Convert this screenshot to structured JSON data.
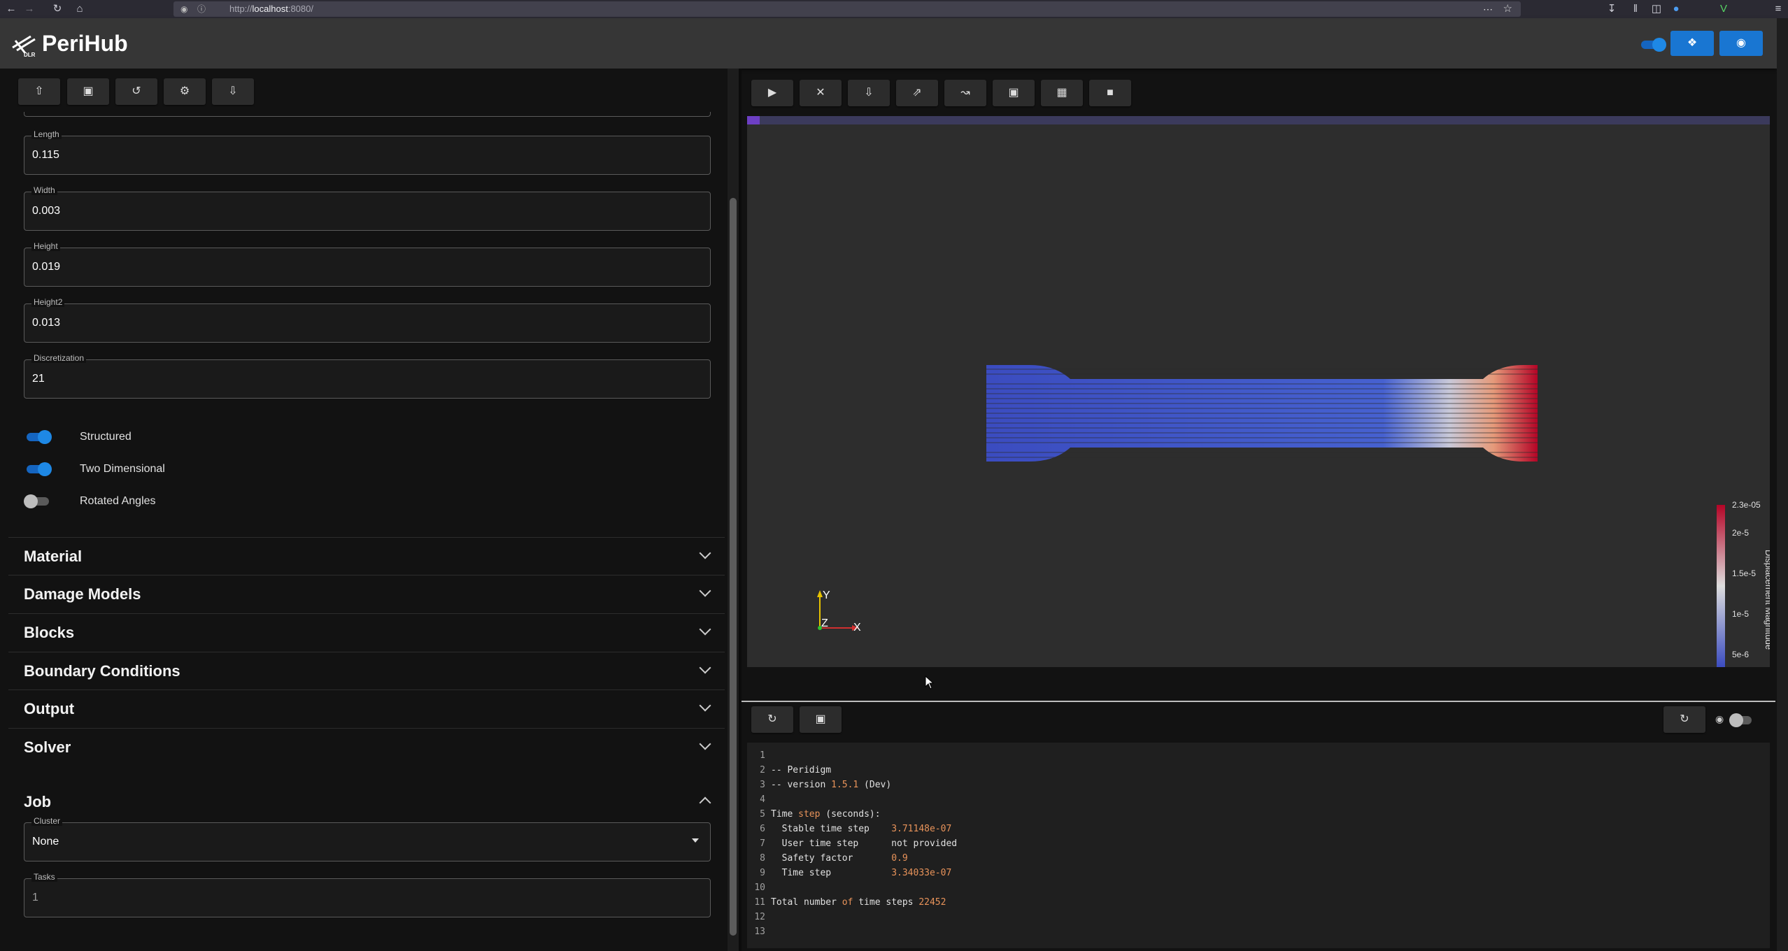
{
  "browser": {
    "url_prefix": "http://",
    "url_host": "localhost",
    "url_rest": ":8080/"
  },
  "app": {
    "title": "PeriHub",
    "logo_text": "DLR"
  },
  "geometry": {
    "fields": [
      {
        "label": "Length",
        "value": "0.115"
      },
      {
        "label": "Width",
        "value": "0.003"
      },
      {
        "label": "Height",
        "value": "0.019"
      },
      {
        "label": "Height2",
        "value": "0.013"
      },
      {
        "label": "Discretization",
        "value": "21"
      }
    ],
    "switches": [
      {
        "label": "Structured",
        "on": true
      },
      {
        "label": "Two Dimensional",
        "on": true
      },
      {
        "label": "Rotated Angles",
        "on": false
      }
    ]
  },
  "panels": [
    {
      "title": "Material",
      "expanded": false
    },
    {
      "title": "Damage Models",
      "expanded": false
    },
    {
      "title": "Blocks",
      "expanded": false
    },
    {
      "title": "Boundary Conditions",
      "expanded": false
    },
    {
      "title": "Output",
      "expanded": false
    },
    {
      "title": "Solver",
      "expanded": false
    },
    {
      "title": "Job",
      "expanded": true
    }
  ],
  "job": {
    "cluster_label": "Cluster",
    "cluster_value": "None",
    "tasks_label": "Tasks",
    "tasks_value": "1"
  },
  "viewer": {
    "colorbar_ticks": [
      "2.3e-05",
      "2e-5",
      "1.5e-5",
      "1e-5",
      "5e-6"
    ],
    "colorbar_title": "Displacement Magnitude",
    "axes": {
      "y": "Y",
      "x": "X",
      "z": "Z"
    },
    "colors": {
      "low": "#3b4cc0",
      "mid": "#dddddd",
      "high": "#b40426"
    }
  },
  "log": {
    "lines": [
      {
        "n": "1",
        "parts": []
      },
      {
        "n": "2",
        "parts": [
          {
            "t": "-- Peridigm"
          }
        ]
      },
      {
        "n": "3",
        "parts": [
          {
            "t": "-- version "
          },
          {
            "t": "1.5.1",
            "h": true
          },
          {
            "t": " (Dev)"
          }
        ]
      },
      {
        "n": "4",
        "parts": []
      },
      {
        "n": "5",
        "parts": [
          {
            "t": "Time "
          },
          {
            "t": "step",
            "h": true
          },
          {
            "t": " (seconds):"
          }
        ]
      },
      {
        "n": "6",
        "parts": [
          {
            "t": "  Stable time step    "
          },
          {
            "t": "3.71148e-07",
            "h": true
          }
        ]
      },
      {
        "n": "7",
        "parts": [
          {
            "t": "  User time step      not provided"
          }
        ]
      },
      {
        "n": "8",
        "parts": [
          {
            "t": "  Safety factor       "
          },
          {
            "t": "0.9",
            "h": true
          }
        ]
      },
      {
        "n": "9",
        "parts": [
          {
            "t": "  Time step           "
          },
          {
            "t": "3.34033e-07",
            "h": true
          }
        ]
      },
      {
        "n": "10",
        "parts": []
      },
      {
        "n": "11",
        "parts": [
          {
            "t": "Total number "
          },
          {
            "t": "of",
            "h": true
          },
          {
            "t": " time steps "
          },
          {
            "t": "22452",
            "h": true
          }
        ]
      },
      {
        "n": "12",
        "parts": []
      },
      {
        "n": "13",
        "parts": []
      }
    ]
  },
  "icons": {
    "left_toolbar": [
      "upload-icon",
      "save-icon",
      "reset-icon",
      "settings-icon",
      "download-icon"
    ],
    "right_toolbar": [
      "play-icon",
      "cancel-icon",
      "download-icon",
      "open-external-icon",
      "chart-icon",
      "image-icon",
      "texture-icon",
      "delete-icon"
    ],
    "log_toolbar": [
      "refresh-icon",
      "save-icon"
    ]
  }
}
